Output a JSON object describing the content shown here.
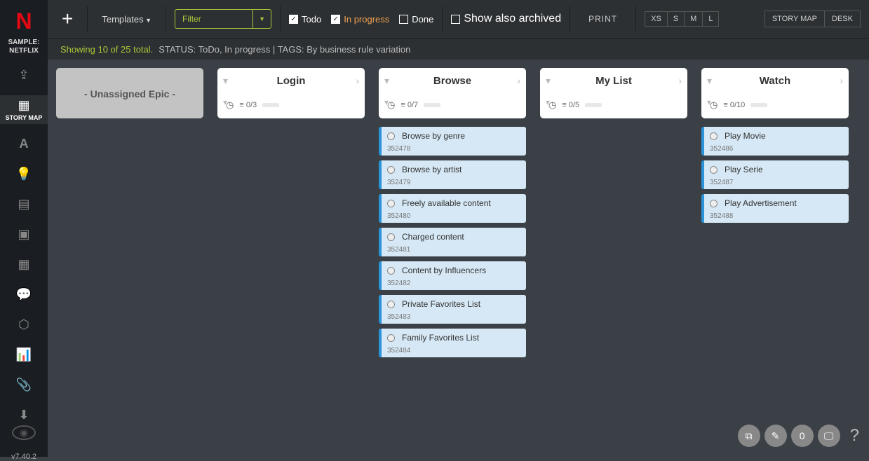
{
  "logo": "N",
  "sample_label": "SAMPLE:\nNETFLIX",
  "story_map_label": "STORY MAP",
  "version": "v7.40.2",
  "toolbar": {
    "templates": "Templates",
    "filter_placeholder": "Filter",
    "todo": "Todo",
    "in_progress": "In progress",
    "done": "Done",
    "show_archived": "Show also archived",
    "print": "PRINT",
    "sizes": [
      "XS",
      "S",
      "M",
      "L"
    ],
    "view_storymap": "STORY MAP",
    "view_desk": "DESK"
  },
  "status": {
    "showing": "Showing 10 of 25 total.",
    "rest": "STATUS: ToDo, In progress | TAGS: By business rule variation"
  },
  "columns": [
    {
      "title": "- Unassigned Epic -",
      "unassigned": true
    },
    {
      "title": "Login",
      "count": "0/3",
      "cards": []
    },
    {
      "title": "Browse",
      "count": "0/7",
      "cards": [
        {
          "title": "Browse by genre",
          "id": "352478"
        },
        {
          "title": "Browse by artist",
          "id": "352479"
        },
        {
          "title": "Freely available content",
          "id": "352480"
        },
        {
          "title": "Charged content",
          "id": "352481"
        },
        {
          "title": "Content by Influencers",
          "id": "352482"
        },
        {
          "title": "Private Favorites List",
          "id": "352483"
        },
        {
          "title": "Family Favorites List",
          "id": "352484"
        }
      ]
    },
    {
      "title": "My List",
      "count": "0/5",
      "cards": []
    },
    {
      "title": "Watch",
      "count": "0/10",
      "cards": [
        {
          "title": "Play Movie",
          "id": "352486"
        },
        {
          "title": "Play Serie",
          "id": "352487"
        },
        {
          "title": "Play Advertisement",
          "id": "352488"
        }
      ]
    }
  ],
  "fab_count": "0"
}
